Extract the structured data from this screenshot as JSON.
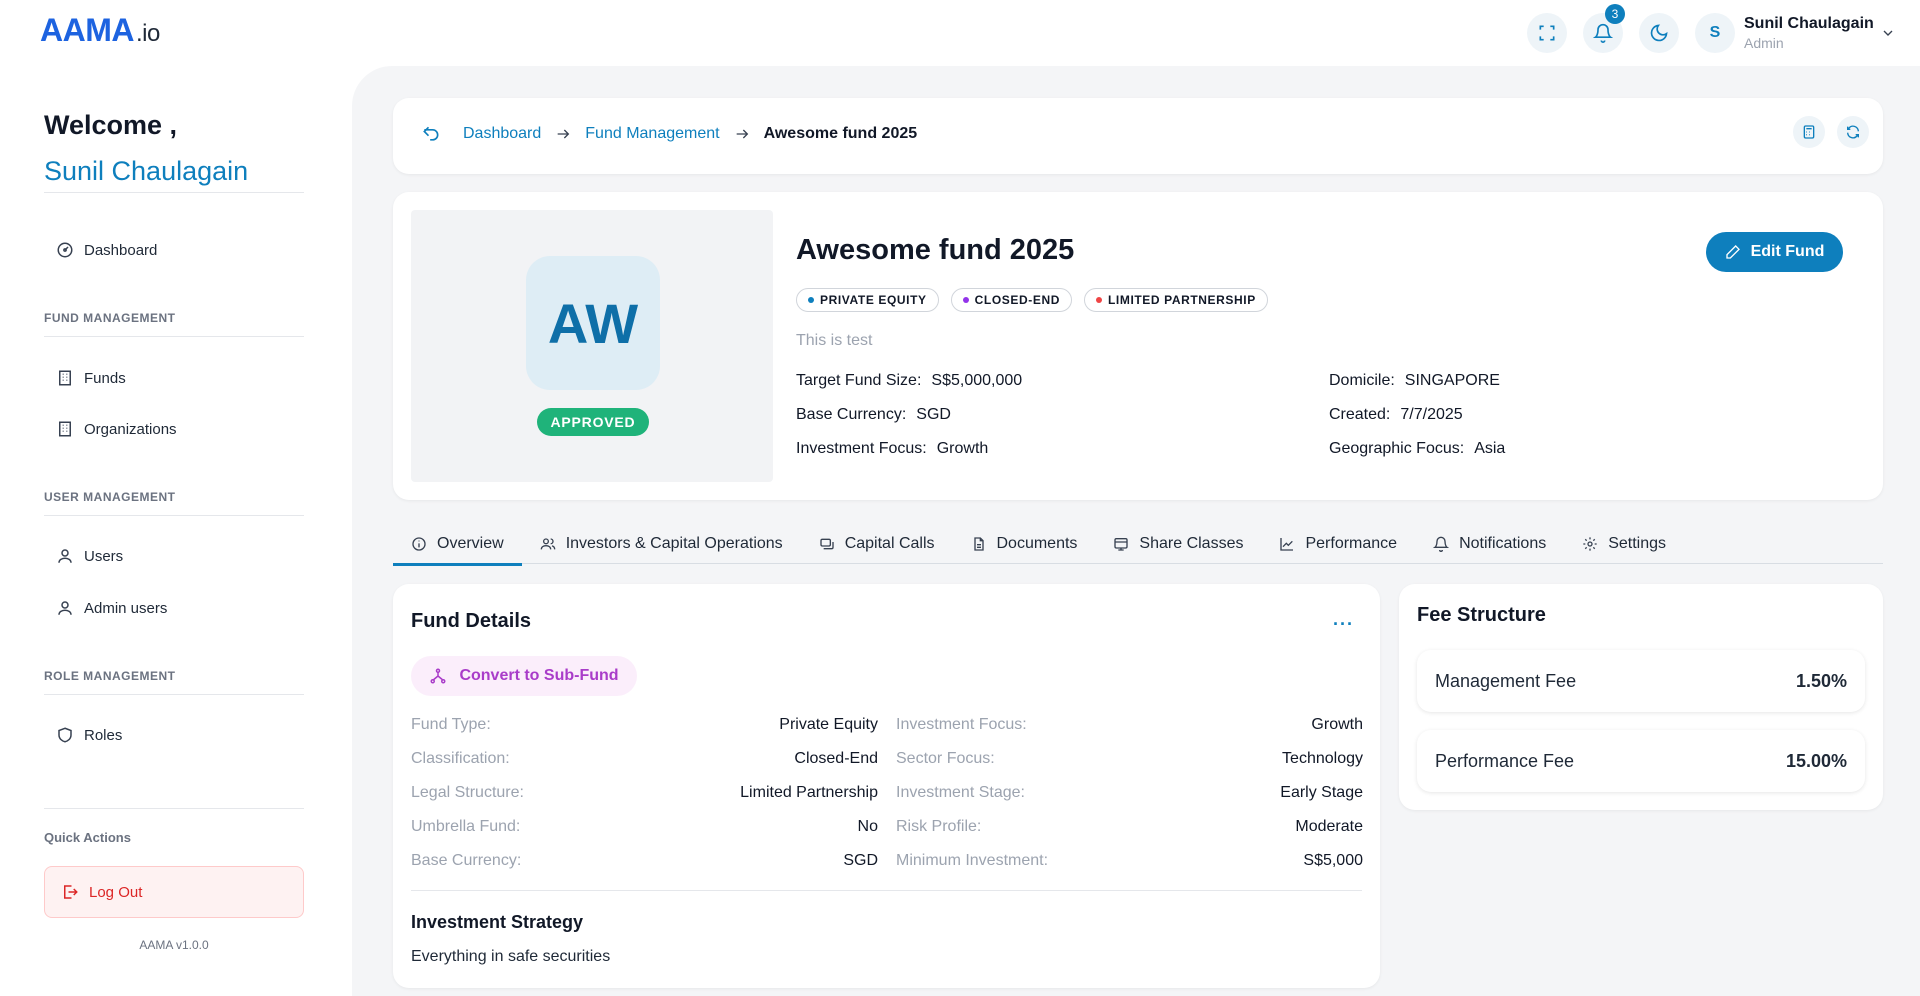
{
  "header": {
    "logo_main": "AAMA",
    "logo_suffix": ".io",
    "notification_count": "3",
    "avatar_initial": "S",
    "user_name": "Sunil Chaulagain",
    "user_role": "Admin"
  },
  "sidebar": {
    "welcome": "Welcome ,",
    "welcome_name": "Sunil Chaulagain",
    "dashboard": "Dashboard",
    "section_fund": "FUND MANAGEMENT",
    "funds": "Funds",
    "organizations": "Organizations",
    "section_user": "USER MANAGEMENT",
    "users": "Users",
    "admin_users": "Admin users",
    "section_role": "ROLE MANAGEMENT",
    "roles": "Roles",
    "quick_actions": "Quick Actions",
    "logout": "Log Out",
    "version": "AAMA v1.0.0"
  },
  "breadcrumb": {
    "dashboard": "Dashboard",
    "fund_management": "Fund Management",
    "current": "Awesome fund 2025"
  },
  "fund": {
    "initials": "AW",
    "status": "APPROVED",
    "title": "Awesome fund 2025",
    "tags": [
      {
        "label": "PRIVATE EQUITY",
        "color": "#0e7fbd"
      },
      {
        "label": "CLOSED-END",
        "color": "#9333ea"
      },
      {
        "label": "LIMITED PARTNERSHIP",
        "color": "#ef4444"
      }
    ],
    "description": "This is test",
    "edit_label": "Edit Fund",
    "info_left": [
      {
        "key": "Target Fund Size:",
        "value": "S$5,000,000"
      },
      {
        "key": "Base Currency:",
        "value": "SGD"
      },
      {
        "key": "Investment Focus:",
        "value": "Growth"
      }
    ],
    "info_right": [
      {
        "key": "Domicile:",
        "value": "SINGAPORE"
      },
      {
        "key": "Created:",
        "value": "7/7/2025"
      },
      {
        "key": "Geographic Focus:",
        "value": "Asia"
      }
    ]
  },
  "tabs": [
    {
      "label": "Overview",
      "icon": "info-icon"
    },
    {
      "label": "Investors & Capital Operations",
      "icon": "users-icon"
    },
    {
      "label": "Capital Calls",
      "icon": "capital-calls-icon"
    },
    {
      "label": "Documents",
      "icon": "document-icon"
    },
    {
      "label": "Share Classes",
      "icon": "share-classes-icon"
    },
    {
      "label": "Performance",
      "icon": "chart-icon"
    },
    {
      "label": "Notifications",
      "icon": "bell-icon"
    },
    {
      "label": "Settings",
      "icon": "gear-icon"
    }
  ],
  "details": {
    "title": "Fund Details",
    "more": "···",
    "convert_label": "Convert to Sub-Fund",
    "left": [
      {
        "key": "Fund Type:",
        "value": "Private Equity"
      },
      {
        "key": "Classification:",
        "value": "Closed-End"
      },
      {
        "key": "Legal Structure:",
        "value": "Limited Partnership"
      },
      {
        "key": "Umbrella Fund:",
        "value": "No"
      },
      {
        "key": "Base Currency:",
        "value": "SGD"
      }
    ],
    "right": [
      {
        "key": "Investment Focus:",
        "value": "Growth"
      },
      {
        "key": "Sector Focus:",
        "value": "Technology"
      },
      {
        "key": "Investment Stage:",
        "value": "Early Stage"
      },
      {
        "key": "Risk Profile:",
        "value": "Moderate"
      },
      {
        "key": "Minimum Investment:",
        "value": "S$5,000"
      }
    ],
    "strategy_title": "Investment Strategy",
    "strategy_text": "Everything in safe securities"
  },
  "fees": {
    "title": "Fee Structure",
    "items": [
      {
        "label": "Management Fee",
        "value": "1.50%"
      },
      {
        "label": "Performance Fee",
        "value": "15.00%"
      }
    ]
  },
  "colors": {
    "accent": "#0e7fbd",
    "logo": "#1d63e0",
    "approved": "#1fb37a",
    "danger": "#dc2626",
    "sub_fund": "#a93cc9"
  }
}
